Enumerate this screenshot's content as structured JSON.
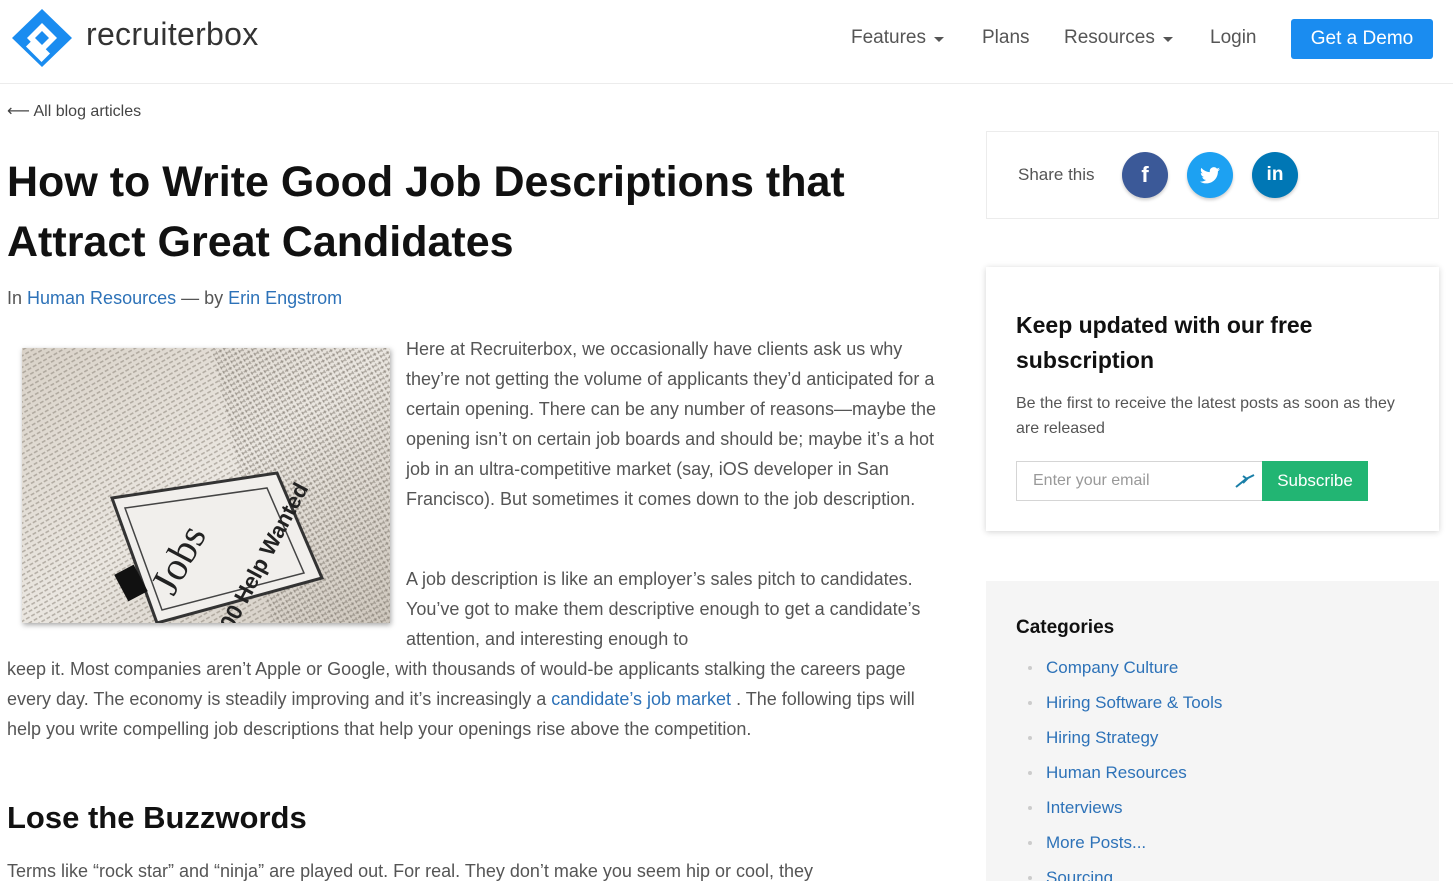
{
  "header": {
    "logo_text": "recruiterbox",
    "nav": [
      {
        "label": "Features",
        "has_caret": true
      },
      {
        "label": "Plans",
        "has_caret": false
      },
      {
        "label": "Resources",
        "has_caret": true
      },
      {
        "label": "Login",
        "has_caret": false
      }
    ],
    "cta_label": "Get a Demo",
    "brand_color": "#1a8cf0"
  },
  "article": {
    "back_link": "⟵ All blog articles",
    "title": "How to Write Good Job Descriptions that Attract Great Candidates",
    "byline": {
      "prefix": "In",
      "category": "Human Resources",
      "separator": "— by",
      "author": "Erin Engstrom"
    },
    "image_alt": "Jobs Help Wanted newspaper",
    "image_text": {
      "jobs": "Jobs",
      "help_wanted": "00 Help Wanted"
    },
    "paragraph1": "Here at Recruiterbox, we occasionally have clients ask us why they’re not getting the volume of applicants they’d anticipated for a certain opening. There can be any number of reasons—maybe the opening isn’t on certain job boards and should be; maybe it’s a hot job in an ultra-competitive market (say, iOS developer in San Francisco). But sometimes it comes down to the job description.",
    "paragraph2_wrap": "A job description is like an employer’s sales pitch to candidates. You’ve got to make them descriptive enough to get a candidate’s attention, and interesting enough to",
    "paragraph2_full_before_link": "keep it. Most companies aren’t Apple or Google, with thousands of would-be applicants stalking the careers page every day. The economy is steadily improving and it’s increasingly a ",
    "paragraph2_link": "candidate’s job market",
    "paragraph2_after_link": ". The following tips will help you write compelling job descriptions that help your openings rise above the competition.",
    "heading2": "Lose the Buzzwords",
    "paragraph3": "Terms like “rock star” and “ninja” are played out. For real. They don’t make you seem hip or cool, they"
  },
  "sidebar": {
    "share_label": "Share this",
    "social": [
      {
        "name": "facebook",
        "glyph": "f",
        "color": "#3b5998"
      },
      {
        "name": "twitter",
        "glyph": "t",
        "color": "#1da1f2"
      },
      {
        "name": "linkedin",
        "glyph": "in",
        "color": "#0077b5"
      }
    ],
    "subscription": {
      "title": "Keep updated with our free subscription",
      "description": "Be the first to receive the latest posts as soon as they are released",
      "email_placeholder": "Enter your email",
      "button_label": "Subscribe",
      "button_color": "#22b573"
    },
    "categories": {
      "title": "Categories",
      "items": [
        "Company Culture",
        "Hiring Software & Tools",
        "Hiring Strategy",
        "Human Resources",
        "Interviews",
        "More Posts...",
        "Sourcing"
      ]
    }
  }
}
